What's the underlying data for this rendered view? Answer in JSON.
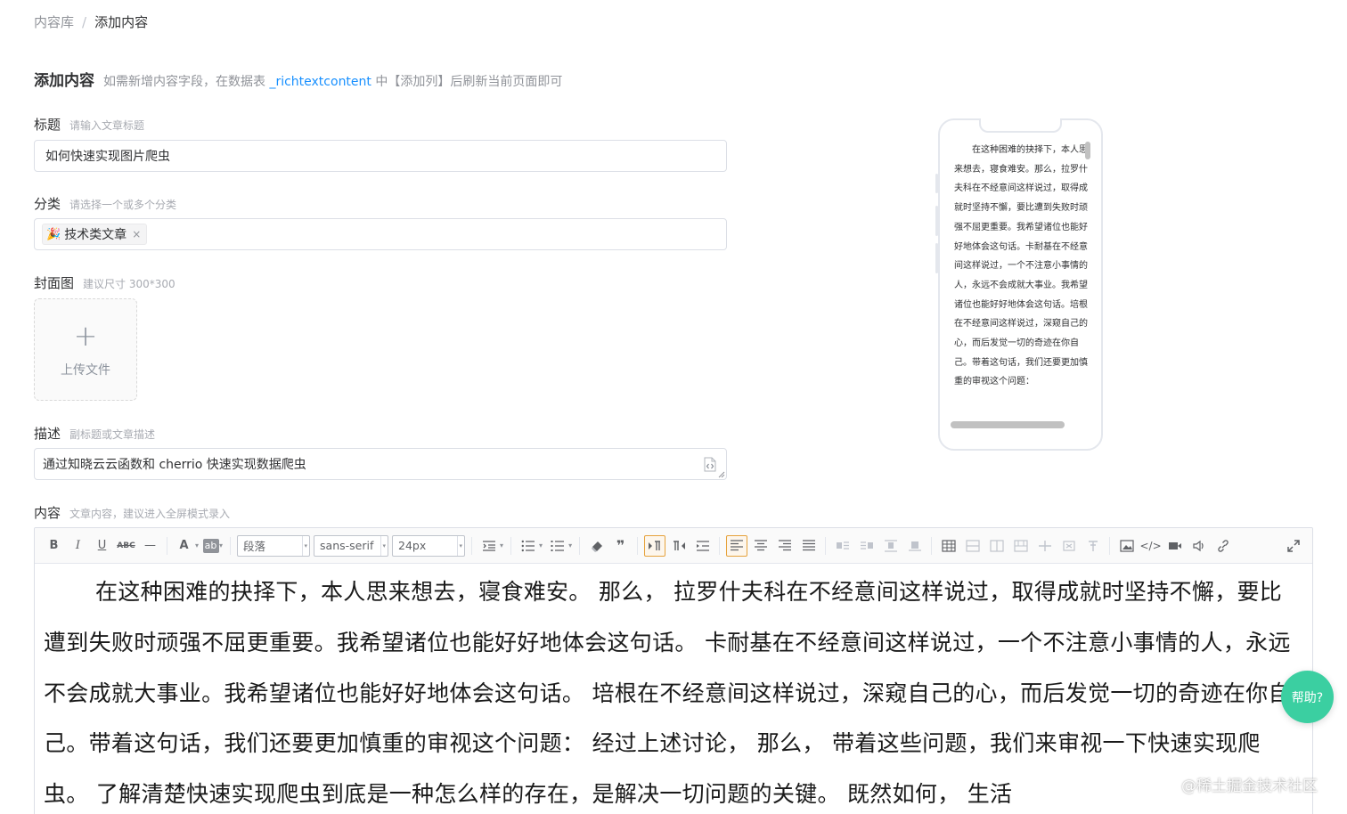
{
  "breadcrumb": {
    "root": "内容库",
    "separator": "/",
    "current": "添加内容"
  },
  "header": {
    "title": "添加内容",
    "tip_prefix": "如需新增内容字段，在数据表",
    "tip_code": "_richtextcontent",
    "tip_suffix": "中【添加列】后刷新当前页面即可"
  },
  "fields": {
    "title": {
      "label": "标题",
      "hint": "请输入文章标题",
      "value": "如何快速实现图片爬虫"
    },
    "category": {
      "label": "分类",
      "hint": "请选择一个或多个分类",
      "tag_emoji": "🎉",
      "tag": "技术类文章",
      "tag_close": "×"
    },
    "cover": {
      "label": "封面图",
      "hint": "建议尺寸 300*300",
      "plus": "+",
      "upload_text": "上传文件"
    },
    "description": {
      "label": "描述",
      "hint": "副标题或文章描述",
      "value": "通过知晓云云函数和 cherrio 快速实现数据爬虫"
    },
    "content": {
      "label": "内容",
      "hint": "文章内容，建议进入全屏模式录入"
    }
  },
  "preview": {
    "text": "在这种困难的抉择下，本人思来想去，寝食难安。那么，拉罗什夫科在不经意间这样说过，取得成就时坚持不懈，要比遭到失败时顽强不屈更重要。我希望诸位也能好好地体会这句话。卡耐基在不经意间这样说过，一个不注意小事情的人，永远不会成就大事业。我希望诸位也能好好地体会这句话。培根在不经意间这样说过，深窥自己的心，而后发觉一切的奇迹在你自己。带着这句话，我们还要更加慎重的审视这个问题："
  },
  "editor": {
    "toolbar": {
      "bold": "B",
      "italic": "I",
      "underline": "U",
      "strike": "ABC",
      "hr": "—",
      "font_color": "A",
      "bg_color": "ab",
      "paragraph": "段落",
      "font_family": "sans-serif",
      "font_size": "24px",
      "quote": "❞",
      "code": "</>",
      "caret": "▾"
    },
    "content": "在这种困难的抉择下，本人思来想去，寝食难安。 那么， 拉罗什夫科在不经意间这样说过，取得成就时坚持不懈，要比遭到失败时顽强不屈更重要。我希望诸位也能好好地体会这句话。 卡耐基在不经意间这样说过，一个不注意小事情的人，永远不会成就大事业。我希望诸位也能好好地体会这句话。 培根在不经意间这样说过，深窥自己的心，而后发觉一切的奇迹在你自己。带着这句话，我们还要更加慎重的审视这个问题： 经过上述讨论， 那么， 带着这些问题，我们来审视一下快速实现爬虫。 了解清楚快速实现爬虫到底是一种怎么样的存在，是解决一切问题的关键。 既然如何， 生活"
  },
  "help": {
    "label": "帮助?"
  },
  "watermark": "@稀土掘金技术社区"
}
